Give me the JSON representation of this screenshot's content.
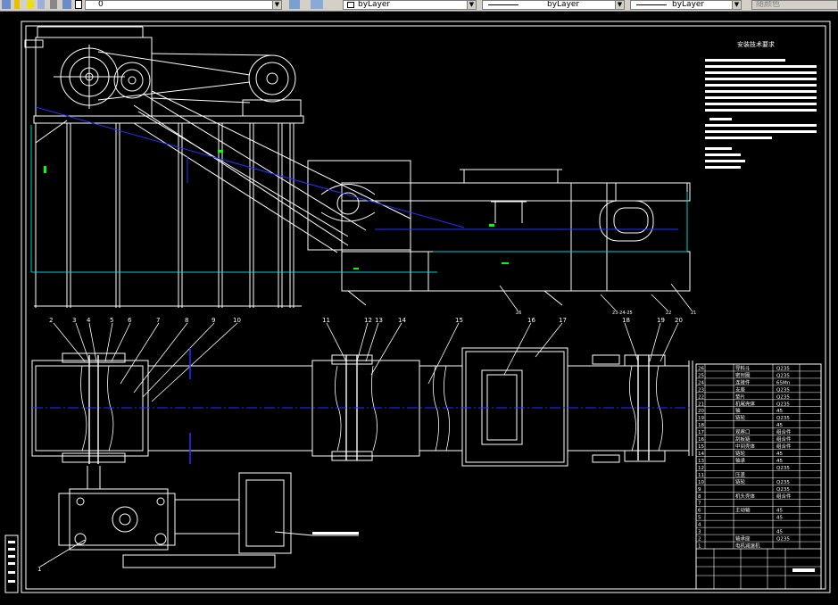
{
  "toolbar": {
    "layer_value": "0",
    "color_value": "byLayer",
    "linetype_value": "byLayer",
    "lineweight_value": "byLayer",
    "plotstyle_value": "随颜色"
  },
  "drawing": {
    "tech_title": "安装技术要求",
    "callouts_top": [
      "2",
      "3",
      "4",
      "5",
      "6",
      "7",
      "8",
      "9",
      "10",
      "11",
      "12",
      "13",
      "14",
      "15",
      "16",
      "17",
      "18",
      "19",
      "20"
    ],
    "callout_1": "1",
    "callouts_top_view": [
      "23-24-25",
      "22",
      "21",
      "26"
    ],
    "bom_rows": [
      {
        "no": "26",
        "name": "导料斗",
        "mat": "Q235"
      },
      {
        "no": "25",
        "name": "密封圈",
        "mat": "Q235"
      },
      {
        "no": "24",
        "name": "连接件",
        "mat": "65Mn"
      },
      {
        "no": "23",
        "name": "支座",
        "mat": "Q235"
      },
      {
        "no": "22",
        "name": "垫片",
        "mat": "Q235"
      },
      {
        "no": "21",
        "name": "机尾壳体",
        "mat": "Q235"
      },
      {
        "no": "20",
        "name": "轴",
        "mat": "45"
      },
      {
        "no": "19",
        "name": "链轮",
        "mat": "Q235"
      },
      {
        "no": "18",
        "name": "",
        "mat": "45"
      },
      {
        "no": "17",
        "name": "观察口",
        "mat": "组合件"
      },
      {
        "no": "16",
        "name": "刮板链",
        "mat": "组合件"
      },
      {
        "no": "15",
        "name": "中间壳体",
        "mat": "组合件"
      },
      {
        "no": "14",
        "name": "链轮",
        "mat": "45"
      },
      {
        "no": "13",
        "name": "轴承",
        "mat": "45"
      },
      {
        "no": "12",
        "name": "",
        "mat": "Q235"
      },
      {
        "no": "11",
        "name": "压盖",
        "mat": ""
      },
      {
        "no": "10",
        "name": "链轮",
        "mat": "Q235"
      },
      {
        "no": "9",
        "name": "",
        "mat": "Q235"
      },
      {
        "no": "8",
        "name": "机头壳体",
        "mat": "组合件"
      },
      {
        "no": "7",
        "name": "",
        "mat": ""
      },
      {
        "no": "6",
        "name": "主动轴",
        "mat": "45"
      },
      {
        "no": "5",
        "name": "",
        "mat": "45"
      },
      {
        "no": "4",
        "name": "",
        "mat": ""
      },
      {
        "no": "3",
        "name": "",
        "mat": "45"
      },
      {
        "no": "2",
        "name": "轴承座",
        "mat": "Q235"
      },
      {
        "no": "1",
        "name": "电机减速机",
        "mat": ""
      }
    ]
  },
  "colors": {
    "background": "#000000",
    "line": "#ffffff",
    "center": "#2233ff",
    "dim": "#00cccc",
    "note": "#00ff00",
    "toolbar": "#d4d0c8"
  }
}
